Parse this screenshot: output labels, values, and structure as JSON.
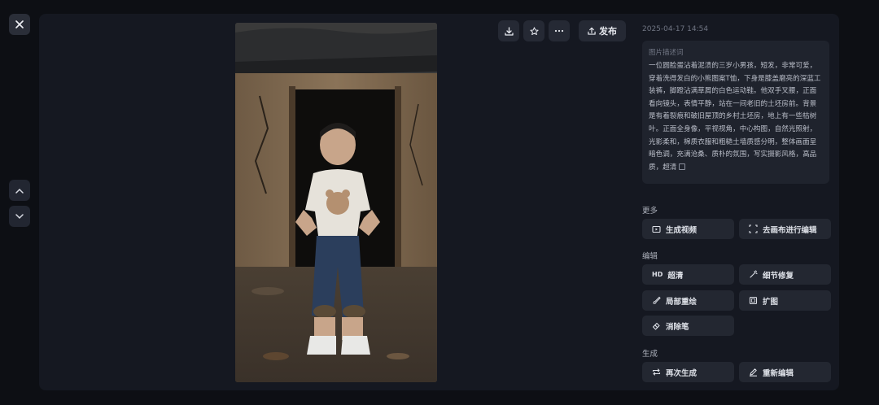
{
  "toolbar": {
    "close_icon": "close-icon",
    "prev_icon": "chevron-up-icon",
    "next_icon": "chevron-down-icon",
    "download_icon": "download-icon",
    "favorite_icon": "star-icon",
    "more_icon": "more-icon",
    "publish_label": "发布"
  },
  "image": {
    "timestamp": "2025-04-17 14:54",
    "description_label": "图片描述词",
    "description": "一位圆脸蛋沾着泥渍的三岁小男孩，短发，非常可爱，穿着洗得发白的小熊图案T恤，下身是膝盖磨亮的深蓝工装裤，脚蹬沾满草屑的白色运动鞋。他双手叉腰，正面看向镜头，表情平静，站在一间老旧的土坯房前。背景是有着裂痕和破旧屋顶的乡村土坯房，地上有一些枯树叶。正面全身像，平视视角，中心构图，自然光照射，光影柔和，棉质衣服和粗糙土墙质感分明，整体画面呈暗色调，充满沧桑、质朴的氛围，写实摄影风格，高品质，超清"
  },
  "sections": {
    "more": {
      "title": "更多",
      "generate_video": "生成视频",
      "canvas_edit": "去画布进行编辑"
    },
    "edit": {
      "title": "编辑",
      "hd_badge": "HD",
      "hd": "超清",
      "detail_fix": "细节修复",
      "inpaint": "局部重绘",
      "expand": "扩图",
      "eraser": "消除笔"
    },
    "generate": {
      "title": "生成",
      "regenerate": "再次生成",
      "reedit": "重新编辑"
    }
  },
  "colors": {
    "background": "#0d0f14",
    "panel": "#151821",
    "button": "#232731"
  }
}
